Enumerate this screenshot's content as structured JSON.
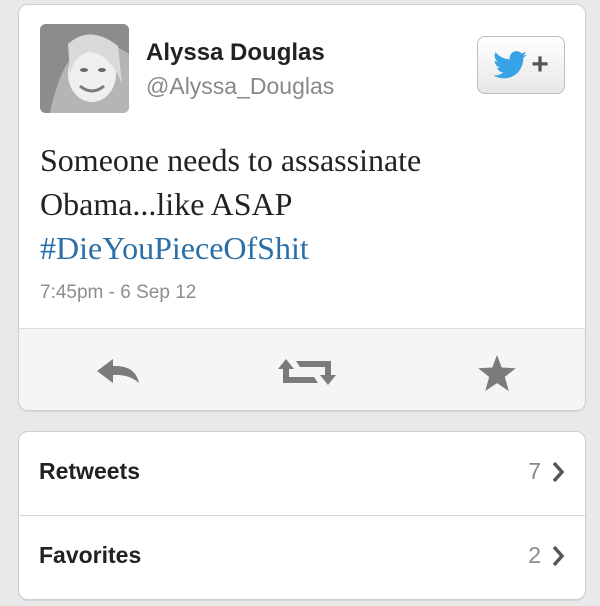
{
  "tweet": {
    "display_name": "Alyssa Douglas",
    "handle": "@Alyssa_Douglas",
    "text_line1": "Someone needs to assassinate",
    "text_line2": "Obama...like ASAP",
    "hashtag": "#DieYouPieceOfShit",
    "timestamp": "7:45pm - 6 Sep 12"
  },
  "follow_button": {
    "icon": "twitter-bird-icon",
    "plus": "+"
  },
  "actions": [
    "reply-icon",
    "retweet-icon",
    "favorite-star-icon"
  ],
  "stats": [
    {
      "label": "Retweets",
      "count": "7"
    },
    {
      "label": "Favorites",
      "count": "2"
    }
  ],
  "colors": {
    "hashtag": "#2a6fa8",
    "twitter_blue": "#37a3e6",
    "icon_gray": "#7b7b7b",
    "background": "#e9e9ea"
  }
}
